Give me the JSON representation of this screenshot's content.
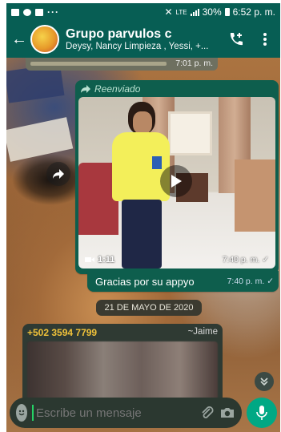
{
  "status_bar": {
    "left_icons": [
      "image-icon",
      "messenger-icon",
      "facebook-icon"
    ],
    "dots": "···",
    "network": "LTE",
    "battery": "30%",
    "time": "6:52 p. m."
  },
  "header": {
    "title": "Grupo parvulos c",
    "members": "Deysy, Nancy Limpieza , Yessi, +...",
    "icons": [
      "back-arrow-icon",
      "add-call-icon",
      "more-vert-icon"
    ]
  },
  "chat": {
    "previous_time": "7:01 p. m.",
    "forwarded_label": "Reenviado",
    "video": {
      "duration": "1:11",
      "time": "7:40 p. m."
    },
    "caption": {
      "text": "Gracias por su appyo",
      "time": "7:40 p. m."
    },
    "date_separator": "21 DE MAYO DE 2020",
    "incoming": {
      "sender_phone": "+502 3594 7799",
      "sender_name": "~Jaime"
    }
  },
  "input": {
    "placeholder": "Escribe un mensaje"
  },
  "colors": {
    "header": "#075e54",
    "bubble_out": "#0e5e4d",
    "sender_phone": "#f0c23a",
    "mic_button": "#00a884"
  }
}
